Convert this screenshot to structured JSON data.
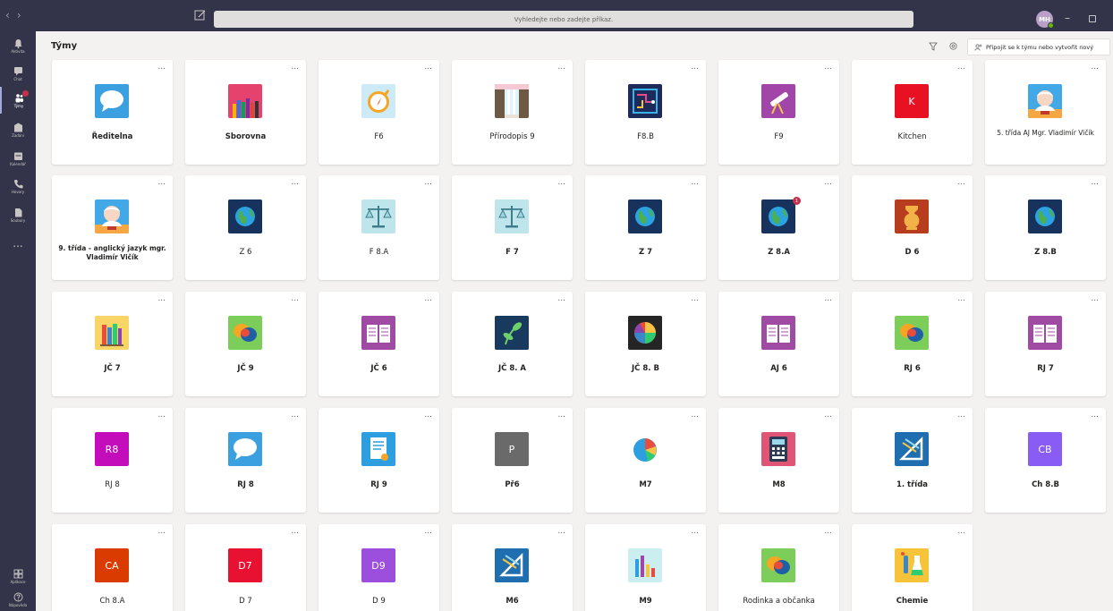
{
  "window": {
    "search_placeholder": "Vyhledejte nebo zadejte příkaz.",
    "user_initials": "MH"
  },
  "rail": {
    "items": [
      {
        "label": "Aktivita",
        "icon": "bell-icon"
      },
      {
        "label": "Chat",
        "icon": "chat-icon"
      },
      {
        "label": "Týmy",
        "icon": "teams-icon",
        "active": true
      },
      {
        "label": "Zadání",
        "icon": "assignments-icon"
      },
      {
        "label": "Kalendář",
        "icon": "calendar-icon"
      },
      {
        "label": "Hovory",
        "icon": "phone-icon"
      },
      {
        "label": "Soubory",
        "icon": "files-icon"
      }
    ],
    "more": "...",
    "apps_label": "Aplikace",
    "help_label": "Nápověda"
  },
  "header": {
    "title": "Týmy",
    "join_label": "Připojit se k týmu nebo vytvořit nový"
  },
  "teams": [
    {
      "name": "Ředitelna",
      "bold": true,
      "tile": "speech-bubble",
      "bg": "#3aa0e0"
    },
    {
      "name": "Sborovna",
      "bold": true,
      "tile": "pencils",
      "bg": "#e6426e"
    },
    {
      "name": "F6",
      "bold": false,
      "tile": "compass",
      "bg": "#cdeaf7"
    },
    {
      "name": "Přírodopis 9",
      "bold": false,
      "tile": "waterfall",
      "bg": "#c8b8a6"
    },
    {
      "name": "F8.B",
      "bold": false,
      "tile": "circuit",
      "bg": "#1e2a5a"
    },
    {
      "name": "F9",
      "bold": false,
      "tile": "telescope",
      "bg": "#a245a8"
    },
    {
      "name": "Kitchen",
      "bold": false,
      "tile": "letter",
      "letter": "K",
      "bg": "#e81123"
    },
    {
      "name": "5. třída AJ Mgr. Vladimír Vičík",
      "bold": false,
      "tile": "portrait",
      "bg": "#43a9e6"
    },
    {
      "name": "9. třída - anglický jazyk mgr. Vladimír Vičík",
      "bold": true,
      "tile": "portrait",
      "bg": "#43a9e6"
    },
    {
      "name": "Z 6",
      "bold": false,
      "tile": "globe",
      "bg": "#17325c"
    },
    {
      "name": "F 8.A",
      "bold": false,
      "tile": "scales",
      "bg": "#bfe5ec"
    },
    {
      "name": "F 7",
      "bold": true,
      "tile": "scales",
      "bg": "#bfe5ec"
    },
    {
      "name": "Z 7",
      "bold": true,
      "tile": "globe",
      "bg": "#17325c"
    },
    {
      "name": "Z 8.A",
      "bold": true,
      "tile": "globe",
      "bg": "#17325c",
      "badge": "1"
    },
    {
      "name": "D 6",
      "bold": true,
      "tile": "vase",
      "bg": "#b83c1e"
    },
    {
      "name": "Z 8.B",
      "bold": true,
      "tile": "globe",
      "bg": "#17325c"
    },
    {
      "name": "JČ 7",
      "bold": true,
      "tile": "books",
      "bg": "#f8d566"
    },
    {
      "name": "JČ 9",
      "bold": true,
      "tile": "chat-bubbles",
      "bg": "#7ccd5a"
    },
    {
      "name": "JČ 6",
      "bold": true,
      "tile": "open-book",
      "bg": "#a04ba3"
    },
    {
      "name": "JČ 8. A",
      "bold": true,
      "tile": "plant",
      "bg": "#173a5e"
    },
    {
      "name": "JČ 8. B",
      "bold": true,
      "tile": "color-wheel",
      "bg": "#252525"
    },
    {
      "name": "AJ 6",
      "bold": true,
      "tile": "open-book",
      "bg": "#a04ba3"
    },
    {
      "name": "RJ 6",
      "bold": true,
      "tile": "chat-bubbles",
      "bg": "#7ccd5a"
    },
    {
      "name": "RJ 7",
      "bold": true,
      "tile": "open-book",
      "bg": "#a04ba3"
    },
    {
      "name": "RJ 8",
      "bold": false,
      "tile": "letter",
      "letter": "R8",
      "bg": "#c30dbb"
    },
    {
      "name": "RJ 8",
      "bold": true,
      "tile": "speech-bubble",
      "bg": "#3aa0e0"
    },
    {
      "name": "RJ 9",
      "bold": true,
      "tile": "document",
      "bg": "#2d9fe0"
    },
    {
      "name": "Př6",
      "bold": true,
      "tile": "letter",
      "letter": "P",
      "bg": "#6a6a6a"
    },
    {
      "name": "M7",
      "bold": true,
      "tile": "pie",
      "bg": "#ffffff"
    },
    {
      "name": "M8",
      "bold": true,
      "tile": "calculator",
      "bg": "#e05575"
    },
    {
      "name": "1. třída",
      "bold": true,
      "tile": "geometry",
      "bg": "#1f6fb0"
    },
    {
      "name": "Ch 8.B",
      "bold": true,
      "tile": "letter",
      "letter": "CB",
      "bg": "#8a5cf6"
    },
    {
      "name": "Ch 8.A",
      "bold": false,
      "tile": "letter",
      "letter": "CA",
      "bg": "#da3b01"
    },
    {
      "name": "D 7",
      "bold": false,
      "tile": "letter",
      "letter": "D7",
      "bg": "#e81131"
    },
    {
      "name": "D 9",
      "bold": false,
      "tile": "letter",
      "letter": "D9",
      "bg": "#9b4fdc"
    },
    {
      "name": "M6",
      "bold": true,
      "tile": "geometry",
      "bg": "#1f6fb0"
    },
    {
      "name": "M9",
      "bold": true,
      "tile": "bar-chart",
      "bg": "#cbeff0"
    },
    {
      "name": "Rodinka a občanka",
      "bold": false,
      "tile": "chat-bubbles",
      "bg": "#7ccd5a"
    },
    {
      "name": "Chemie",
      "bold": true,
      "tile": "chemistry",
      "bg": "#f7c338"
    }
  ],
  "more_label": "..."
}
